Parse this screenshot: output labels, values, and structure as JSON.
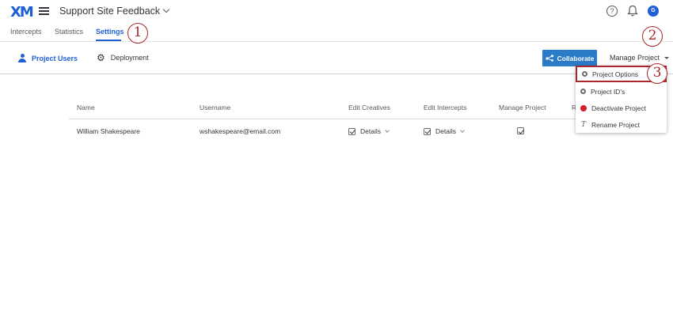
{
  "header": {
    "logo": "XM",
    "project_title": "Support Site Feedback",
    "help_glyph": "?",
    "avatar_initial": "G"
  },
  "tabs": [
    {
      "label": "Intercepts"
    },
    {
      "label": "Statistics"
    },
    {
      "label": "Settings"
    }
  ],
  "badges": [
    "1",
    "2",
    "3"
  ],
  "subnav": {
    "project_users": "Project Users",
    "deployment": "Deployment",
    "collaborate": "Collaborate",
    "manage_project": "Manage Project"
  },
  "table": {
    "headers": [
      "Name",
      "Username",
      "Edit Creatives",
      "Edit Intercepts",
      "Manage Project",
      "R"
    ],
    "row": {
      "name": "William Shakespeare",
      "username": "wshakespeare@email.com",
      "edit_creatives": "Details",
      "edit_intercepts": "Details"
    }
  },
  "menu": {
    "items": [
      {
        "label": "Project Options",
        "icon": "gear-icon"
      },
      {
        "label": "Project ID's",
        "icon": "gear-icon"
      },
      {
        "label": "Deactivate Project",
        "icon": "red-circle-icon"
      },
      {
        "label": "Rename Project",
        "icon": "text-icon"
      }
    ]
  },
  "colors": {
    "accent": "#1f5fd6",
    "button": "#2a7bc8",
    "badge": "#a9272d",
    "deactivate": "#d42029"
  }
}
